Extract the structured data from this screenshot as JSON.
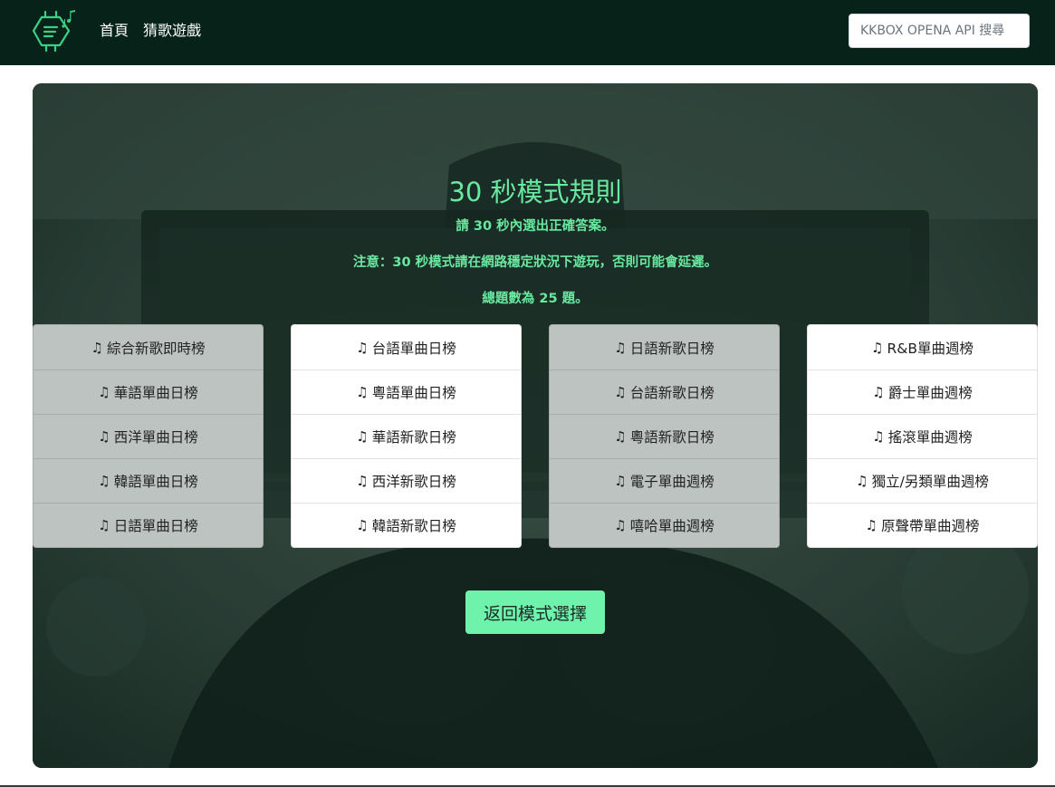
{
  "navbar": {
    "links": [
      "首頁",
      "猜歌遊戲"
    ],
    "search_placeholder": "KKBOX OPENA API 搜尋"
  },
  "rules": {
    "title": "30 秒模式規則",
    "lines": [
      "請 30 秒內選出正確答案。",
      "注意：30 秒模式請在網路穩定狀況下遊玩，否則可能會延遲。",
      "總題數為 25 題。"
    ]
  },
  "charts": [
    [
      "綜合新歌即時榜",
      "華語單曲日榜",
      "西洋單曲日榜",
      "韓語單曲日榜",
      "日語單曲日榜"
    ],
    [
      "台語單曲日榜",
      "粵語單曲日榜",
      "華語新歌日榜",
      "西洋新歌日榜",
      "韓語新歌日榜"
    ],
    [
      "日語新歌日榜",
      "台語新歌日榜",
      "粵語新歌日榜",
      "電子單曲週榜",
      "嘻哈單曲週榜"
    ],
    [
      "R&B單曲週榜",
      "爵士單曲週榜",
      "搖滾單曲週榜",
      "獨立/另類單曲週榜",
      "原聲帶單曲週榜"
    ]
  ],
  "back_button_label": "返回模式選擇",
  "icons": {
    "logo": "robot-music-logo-icon",
    "list": "music-note-icon"
  },
  "colors": {
    "navbar_bg": "#062219",
    "accent_green": "#69e8a0",
    "button_green": "#6ff2ab",
    "list_gray": "#bcc3c0",
    "list_white": "#ffffff"
  }
}
